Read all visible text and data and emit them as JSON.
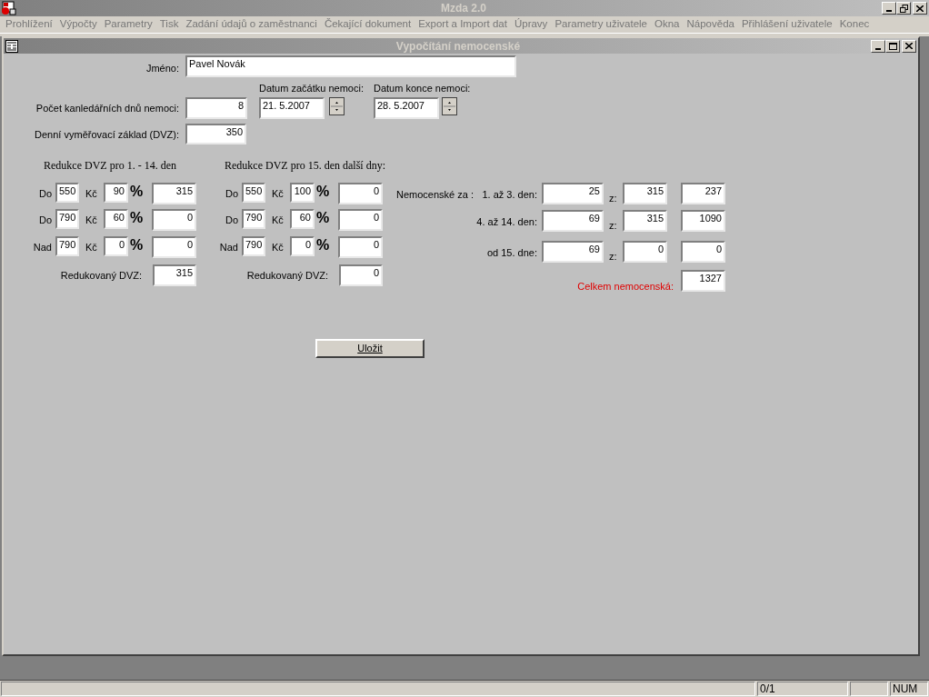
{
  "window": {
    "title": "Mzda 2.0"
  },
  "menu": [
    {
      "label": "Prohlížení"
    },
    {
      "label": "Výpočty"
    },
    {
      "label": "Parametry"
    },
    {
      "label": "Tisk"
    },
    {
      "label": "Zadání údajů o zaměstnanci"
    },
    {
      "label": "Čekající dokument"
    },
    {
      "label": "Export a Import dat"
    },
    {
      "label": "Úpravy"
    },
    {
      "label": "Parametry uživatele"
    },
    {
      "label": "Okna"
    },
    {
      "label": "Nápověda"
    },
    {
      "label": "Přihlášení uživatele"
    },
    {
      "label": "Konec"
    }
  ],
  "child_window": {
    "title": "Vypočítání nemocenské"
  },
  "form": {
    "name_label": "Jméno:",
    "name_value": "Pavel Novák",
    "days_label": "Počet kanledářních dnů nemoci:",
    "days_value": "8",
    "start_label": "Datum začátku nemoci:",
    "start_value": "21. 5.2007",
    "end_label": "Datum konce nemoci:",
    "end_value": "28. 5.2007",
    "dvz_label": "Denní vyměřovací základ (DVZ):",
    "dvz_value": "350"
  },
  "reductions": [
    {
      "title": "Redukce DVZ pro 1. - 14. den",
      "rows": [
        {
          "label": "Do",
          "limit": "550",
          "currency": "Kč",
          "percent": "90",
          "percent_sign": "%",
          "result": "315"
        },
        {
          "label": "Do",
          "limit": "790",
          "currency": "Kč",
          "percent": "60",
          "percent_sign": "%",
          "result": "0"
        },
        {
          "label": "Nad",
          "limit": "790",
          "currency": "Kč",
          "percent": "0",
          "percent_sign": "%",
          "result": "0"
        }
      ],
      "reduced_label": "Redukovaný DVZ:",
      "reduced_value": "315"
    },
    {
      "title": "Redukce DVZ pro 15. den další dny:",
      "rows": [
        {
          "label": "Do",
          "limit": "550",
          "currency": "Kč",
          "percent": "100",
          "percent_sign": "%",
          "result": "0"
        },
        {
          "label": "Do",
          "limit": "790",
          "currency": "Kč",
          "percent": "60",
          "percent_sign": "%",
          "result": "0"
        },
        {
          "label": "Nad",
          "limit": "790",
          "currency": "Kč",
          "percent": "0",
          "percent_sign": "%",
          "result": "0"
        }
      ],
      "reduced_label": "Redukovaný DVZ:",
      "reduced_value": "0"
    }
  ],
  "sick_pay": {
    "label": "Nemocenské za :",
    "rows": [
      {
        "label": "1. až 3. den:",
        "rate": "25",
        "of": "z:",
        "base": "315",
        "amount": "237"
      },
      {
        "label": "4. až 14. den:",
        "rate": "69",
        "of": "z:",
        "base": "315",
        "amount": "1090"
      },
      {
        "label": "od 15. dne:",
        "rate": "69",
        "of": "z:",
        "base": "0",
        "amount": "0"
      }
    ],
    "total_label": "Celkem nemocenská:",
    "total_value": "1327"
  },
  "save_button": "Uložit",
  "status_bar": [
    "0/1",
    "NUM"
  ]
}
